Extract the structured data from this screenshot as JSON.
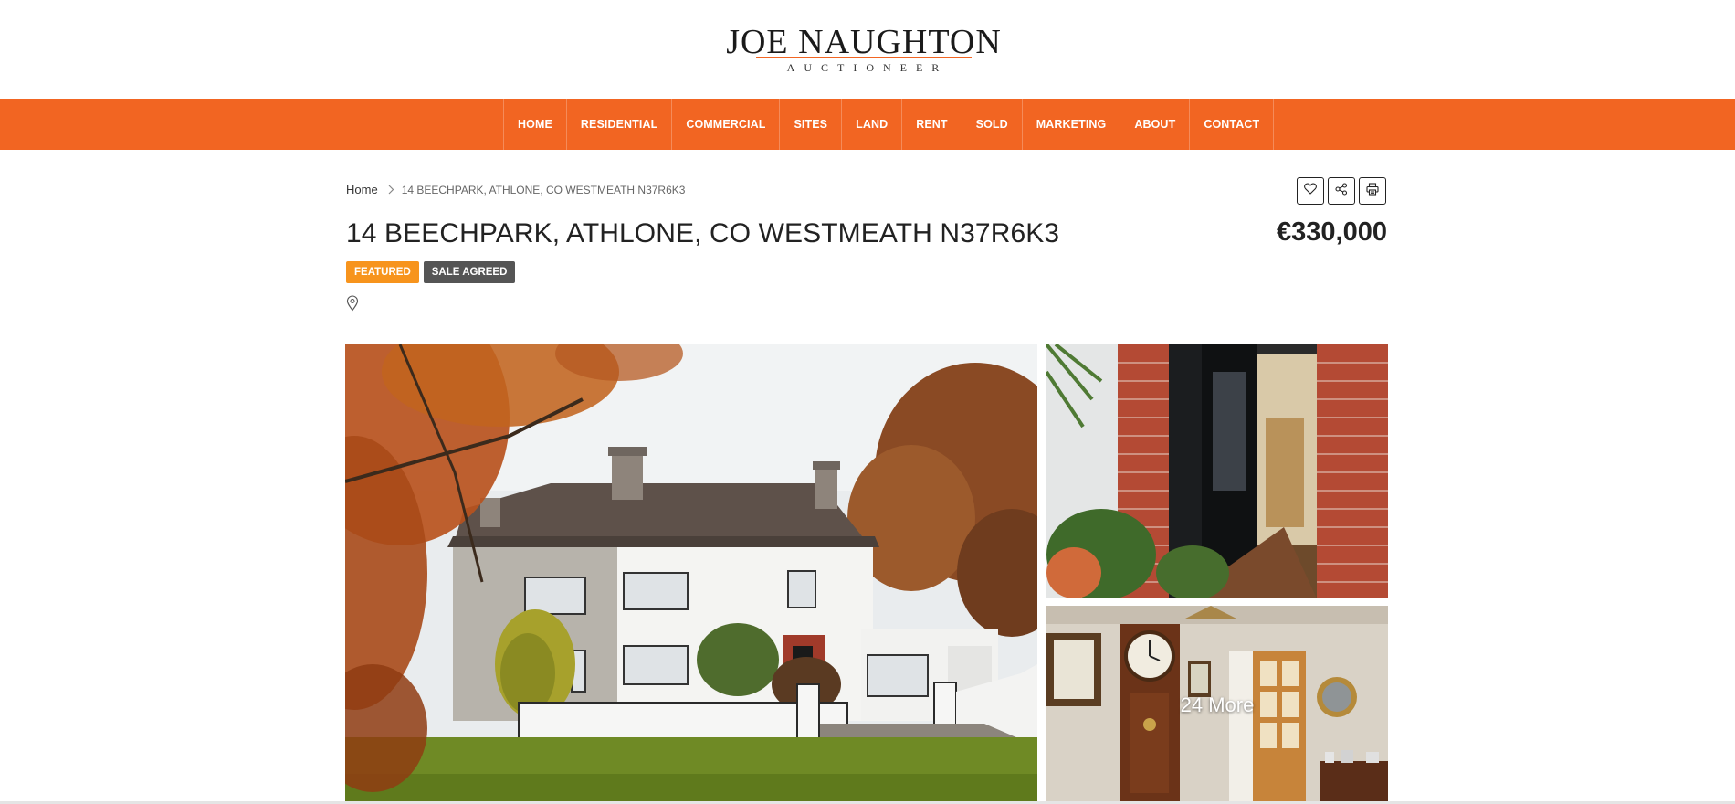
{
  "brand": {
    "name": "JOE NAUGHTON",
    "tagline": "AUCTIONEER",
    "accent_color": "#f26522"
  },
  "nav": {
    "items": [
      {
        "label": "HOME"
      },
      {
        "label": "RESIDENTIAL"
      },
      {
        "label": "COMMERCIAL"
      },
      {
        "label": "SITES"
      },
      {
        "label": "LAND"
      },
      {
        "label": "RENT"
      },
      {
        "label": "SOLD"
      },
      {
        "label": "MARKETING"
      },
      {
        "label": "ABOUT"
      },
      {
        "label": "CONTACT"
      }
    ]
  },
  "breadcrumb": {
    "home": "Home",
    "separator_icon": "chevron-right-icon",
    "current": "14 BEECHPARK, ATHLONE, CO WESTMEATH N37R6K3"
  },
  "actions": [
    {
      "icon": "heart-icon"
    },
    {
      "icon": "share-icon"
    },
    {
      "icon": "print-icon"
    }
  ],
  "property": {
    "title": "14 BEECHPARK, ATHLONE, CO WESTMEATH N37R6K3",
    "price": "€330,000",
    "labels": {
      "featured": "FEATURED",
      "status": "SALE AGREED"
    },
    "label_colors": {
      "featured": "#f7941d",
      "status": "#555555"
    },
    "location_icon": "map-pin-icon"
  },
  "gallery": {
    "more_text": "24 More"
  }
}
